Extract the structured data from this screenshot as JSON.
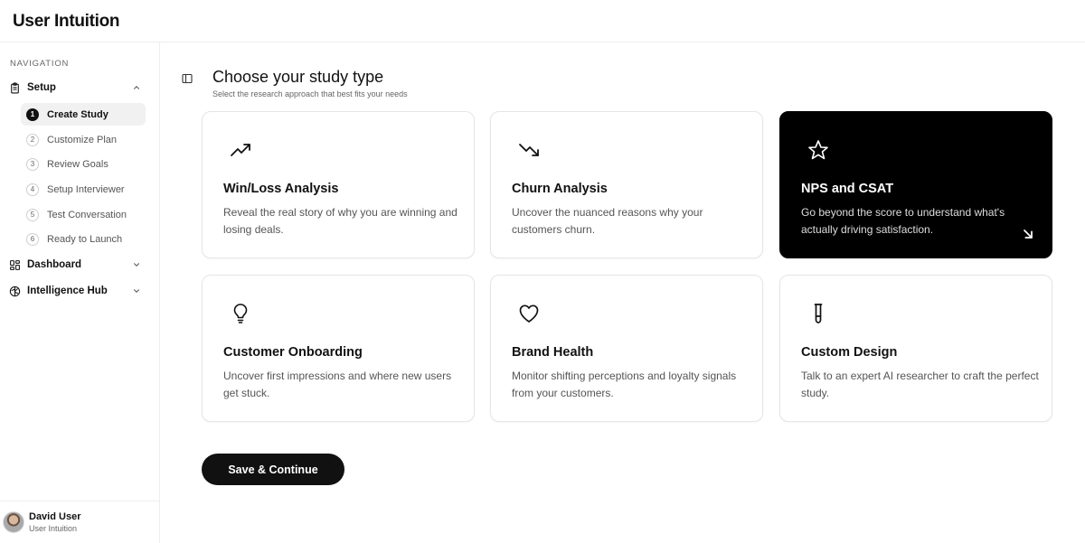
{
  "app": {
    "title": "User Intuition"
  },
  "sidebar": {
    "heading": "NAVIGATION",
    "groups": [
      {
        "label": "Setup",
        "icon": "clipboard-icon",
        "expanded": true
      },
      {
        "label": "Dashboard",
        "icon": "grid-icon",
        "expanded": false
      },
      {
        "label": "Intelligence Hub",
        "icon": "brain-icon",
        "expanded": false
      }
    ],
    "steps": [
      {
        "num": "1",
        "label": "Create Study",
        "active": true
      },
      {
        "num": "2",
        "label": "Customize Plan"
      },
      {
        "num": "3",
        "label": "Review Goals"
      },
      {
        "num": "4",
        "label": "Setup Interviewer"
      },
      {
        "num": "5",
        "label": "Test Conversation"
      },
      {
        "num": "6",
        "label": "Ready to Launch"
      }
    ]
  },
  "user": {
    "name": "David User",
    "org": "User Intuition"
  },
  "main": {
    "title": "Choose your study type",
    "subtitle": "Select the research approach that best fits your needs",
    "cards": [
      {
        "title": "Win/Loss Analysis",
        "desc": "Reveal the real story of why you are winning and losing deals.",
        "icon": "trending-up-icon"
      },
      {
        "title": "Churn Analysis",
        "desc": "Uncover the nuanced reasons why your customers churn.",
        "icon": "trending-down-icon"
      },
      {
        "title": "NPS and CSAT",
        "desc": "Go beyond the score to understand what's actually driving satisfaction.",
        "icon": "star-icon",
        "selected": true
      },
      {
        "title": "Customer Onboarding",
        "desc": "Uncover first impressions and where new users get stuck.",
        "icon": "lightbulb-icon"
      },
      {
        "title": "Brand Health",
        "desc": "Monitor shifting perceptions and loyalty signals from your customers.",
        "icon": "heart-icon"
      },
      {
        "title": "Custom Design",
        "desc": "Talk to an expert AI researcher to craft the perfect study.",
        "icon": "test-tube-icon"
      }
    ],
    "save_label": "Save & Continue"
  },
  "colors": {
    "accent": "#000000",
    "muted_text": "#555555",
    "border": "#e5e5e5"
  }
}
